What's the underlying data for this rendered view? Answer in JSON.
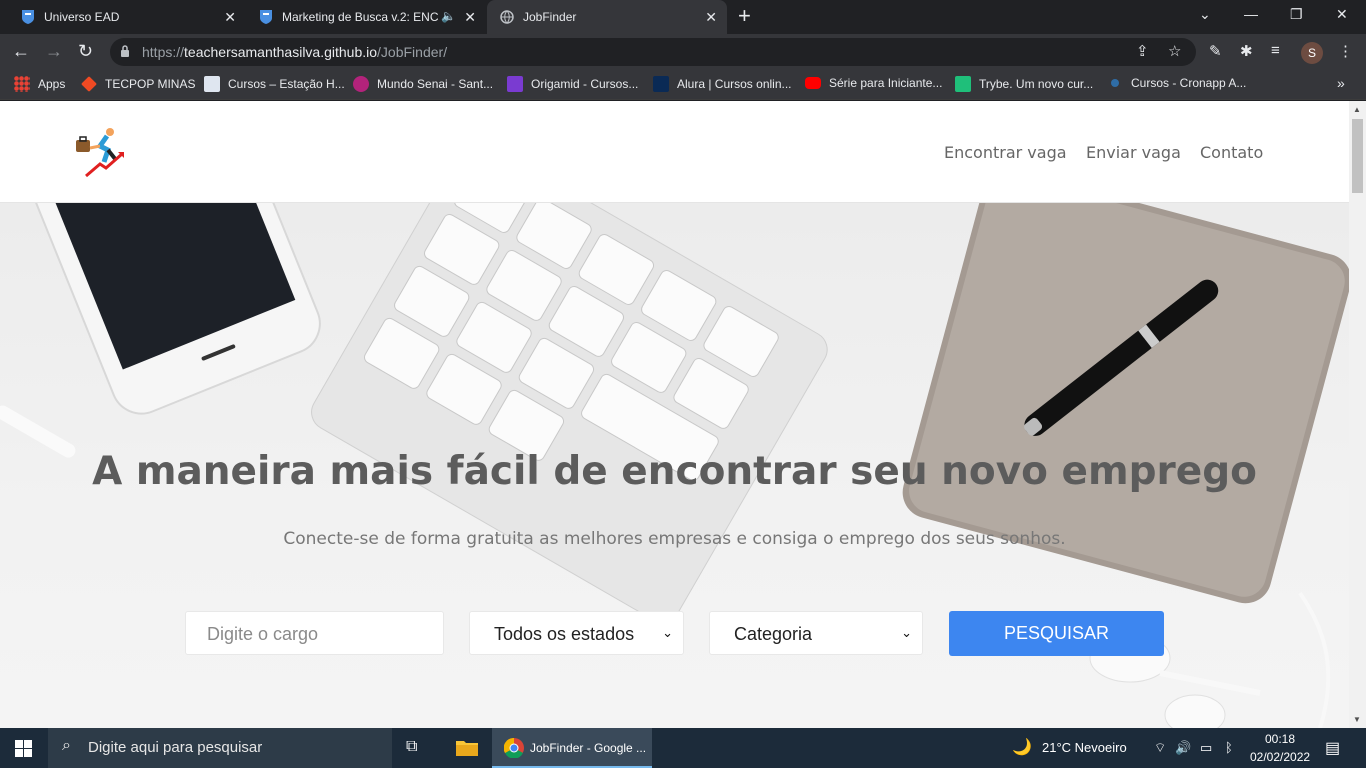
{
  "browser": {
    "tabs": [
      {
        "title": "Universo EAD",
        "active": false
      },
      {
        "title": "Marketing de Busca v.2: ENC",
        "active": false
      },
      {
        "title": "JobFinder",
        "active": true
      }
    ],
    "url_prefix": "https://",
    "url_host": "teachersamanthasilva.github.io",
    "url_path": "/JobFinder/",
    "profile_initial": "S",
    "bookmarks": [
      {
        "label": "Apps",
        "color": "#e8a838"
      },
      {
        "label": "TECPOP MINAS",
        "color": "#f04a23"
      },
      {
        "label": "Cursos – Estação H...",
        "color": "#dfe6f0"
      },
      {
        "label": "Mundo Senai - Sant...",
        "color": "#b3237b"
      },
      {
        "label": "Origamid - Cursos...",
        "color": "#7a3bd1"
      },
      {
        "label": "Alura | Cursos onlin...",
        "color": "#0a2a55"
      },
      {
        "label": "Série para Iniciante...",
        "color": "#ff0000"
      },
      {
        "label": "Trybe. Um novo cur...",
        "color": "#1fbf7a"
      },
      {
        "label": "Cursos - Cronapp A...",
        "color": "#2f6da6"
      }
    ]
  },
  "site": {
    "nav": {
      "find": "Encontrar vaga",
      "post": "Enviar vaga",
      "contact": "Contato"
    },
    "hero": {
      "title": "A maneira mais fácil de encontrar seu novo emprego",
      "subtitle": "Conecte-se de forma gratuita as melhores empresas e consiga o emprego dos seus sonhos."
    },
    "search": {
      "placeholder": "Digite o cargo",
      "state_selected": "Todos os estados",
      "category_selected": "Categoria",
      "button": "PESQUISAR"
    },
    "accent_color": "#3d86f0"
  },
  "taskbar": {
    "search_text": "Digite aqui para pesquisar",
    "app_label": "JobFinder - Google ...",
    "weather": "21°C  Nevoeiro",
    "time": "00:18",
    "date": "02/02/2022"
  }
}
